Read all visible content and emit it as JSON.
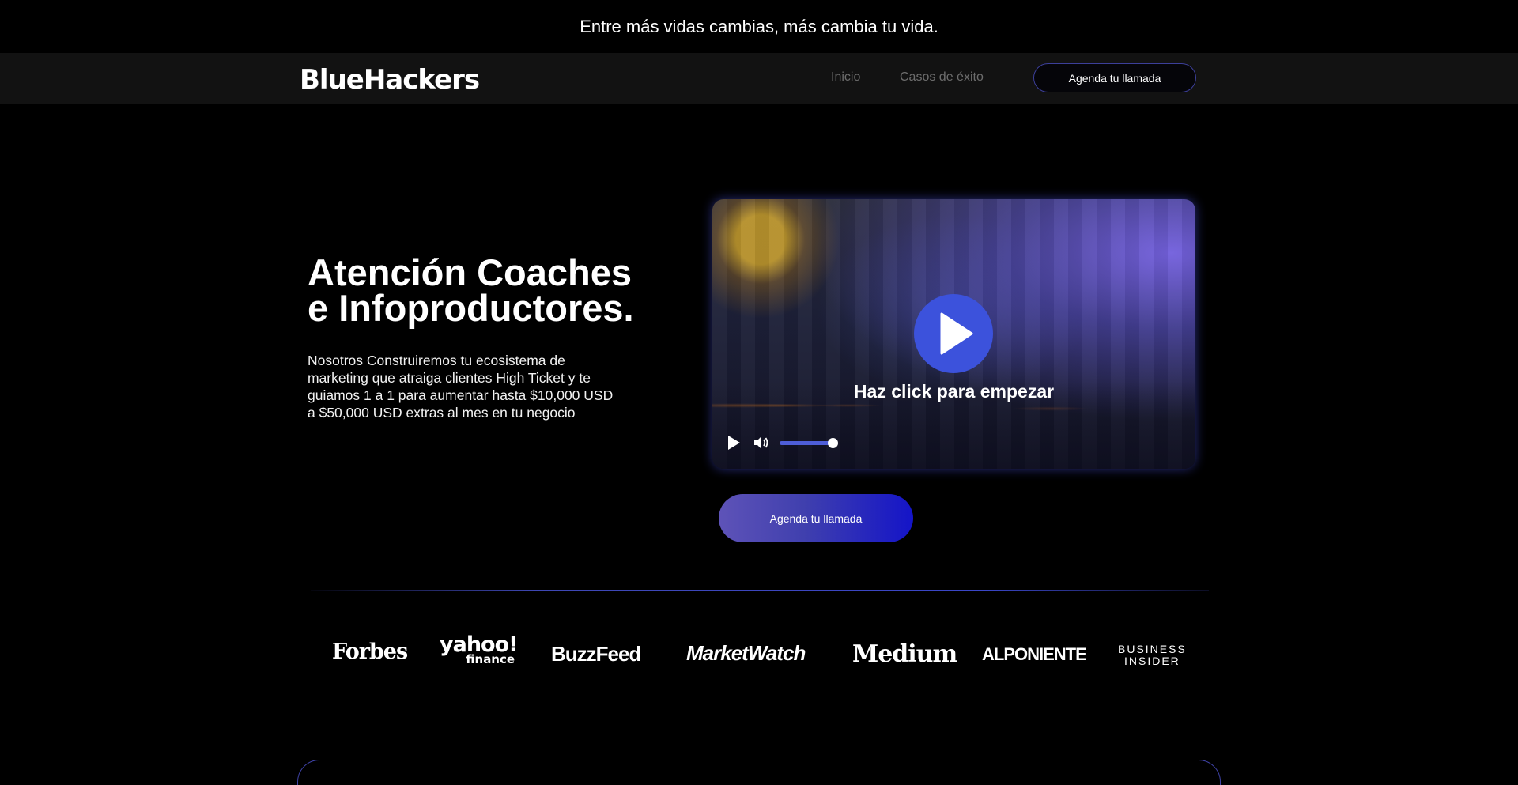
{
  "announcement": {
    "text": "Entre más vidas cambias, más cambia tu vida."
  },
  "nav": {
    "logo": "BlueHackers",
    "links": [
      {
        "label": "Inicio"
      },
      {
        "label": "Casos de éxito"
      }
    ],
    "cta_label": "Agenda tu llamada"
  },
  "hero": {
    "title_line1": "Atención Coaches",
    "title_line2": "e Infoproductores.",
    "description": "Nosotros Construiremos tu ecosistema de marketing que atraiga clientes High Ticket y te guiamos 1 a 1 para aumentar hasta $10,000 USD a $50,000 USD extras al mes en tu negocio",
    "cta_label": "Agenda tu llamada"
  },
  "video": {
    "caption": "Haz click para empezar",
    "volume_fraction": 1.0,
    "icons": [
      "play-icon",
      "play-icon",
      "volume-icon"
    ]
  },
  "press": {
    "logos": [
      {
        "name": "Forbes"
      },
      {
        "name_top": "yahoo!",
        "name_bottom": "finance"
      },
      {
        "name": "BuzzFeed"
      },
      {
        "name": "MarketWatch"
      },
      {
        "name": "Medium"
      },
      {
        "name": "ALPONIENTE"
      },
      {
        "name_top": "BUSINESS",
        "name_bottom": "INSIDER"
      }
    ]
  },
  "colors": {
    "accent": "#3c52dc",
    "cta_gradient_start": "#5e53b8",
    "cta_gradient_end": "#1414c8",
    "nav_background": "#121212",
    "page_background": "#000000"
  }
}
